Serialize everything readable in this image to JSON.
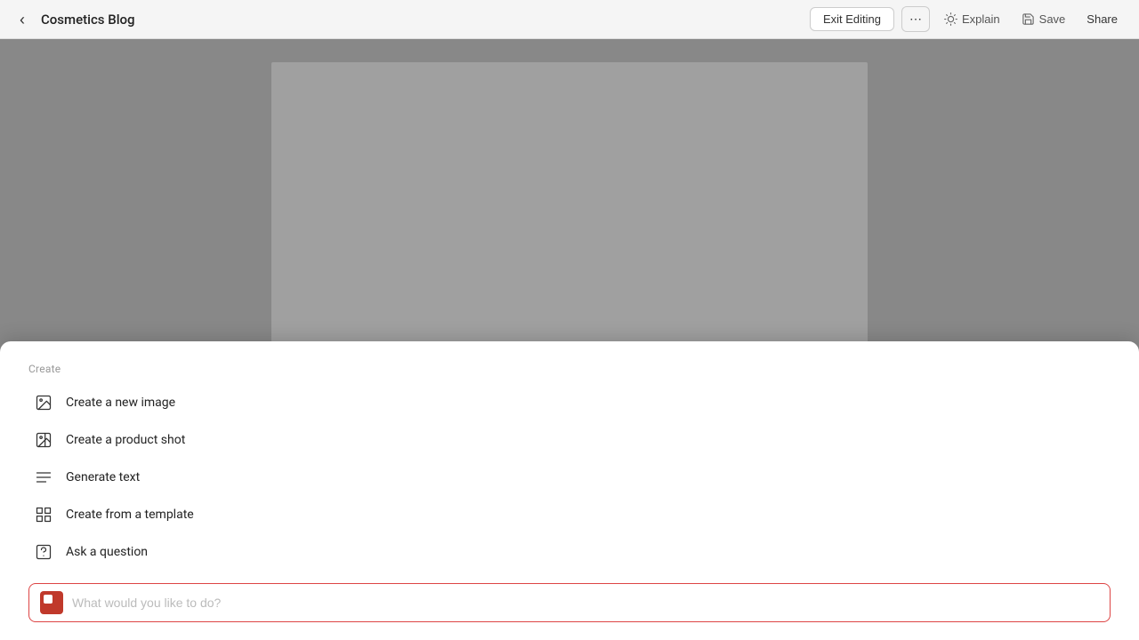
{
  "topbar": {
    "title": "Cosmetics Blog",
    "back_icon": "‹",
    "more_icon": "⋯",
    "exit_editing_label": "Exit Editing",
    "explain_label": "Explain",
    "save_label": "Save",
    "share_label": "Share"
  },
  "panel": {
    "section_label": "Create",
    "menu_items": [
      {
        "id": "create-new-image",
        "label": "Create a new image",
        "icon": "image"
      },
      {
        "id": "create-product-shot",
        "label": "Create a product shot",
        "icon": "product"
      },
      {
        "id": "generate-text",
        "label": "Generate text",
        "icon": "text-lines"
      },
      {
        "id": "create-from-template",
        "label": "Create from a template",
        "icon": "grid"
      },
      {
        "id": "ask-question",
        "label": "Ask a question",
        "icon": "question-image"
      }
    ],
    "input_placeholder": "What would you like to do?"
  }
}
